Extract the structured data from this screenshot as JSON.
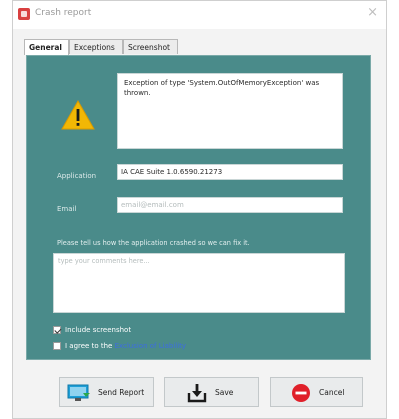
{
  "window": {
    "title": "Crash report",
    "close_glyph": "×"
  },
  "tabs": [
    {
      "label": "General",
      "active": true
    },
    {
      "label": "Exceptions",
      "active": false
    },
    {
      "label": "Screenshot",
      "active": false
    }
  ],
  "general": {
    "icon": "warning-icon",
    "message": "Exception of type 'System.OutOfMemoryException' was thrown.",
    "application_label": "Application",
    "application_value": "IA CAE Suite 1.0.6590.21273",
    "email_label": "Email",
    "email_placeholder": "email@email.com",
    "prompt": "Please tell us how the application crashed so we can fix it.",
    "comments_placeholder": "type your comments here...",
    "include_screenshot": {
      "label": "Include screenshot",
      "checked": true
    },
    "agree": {
      "label": "I agree to the",
      "link": "Exclusion of Liability",
      "checked": false
    }
  },
  "buttons": {
    "send": {
      "label": "Send Report",
      "icon": "send-report-icon"
    },
    "save": {
      "label": "Save",
      "icon": "save-download-icon"
    },
    "cancel": {
      "label": "Cancel",
      "icon": "cancel-icon"
    }
  },
  "colors": {
    "panel": "#4a8b8a",
    "accent_red": "#e0202a",
    "warning_yellow": "#f2b705",
    "link": "#3d6de0"
  }
}
